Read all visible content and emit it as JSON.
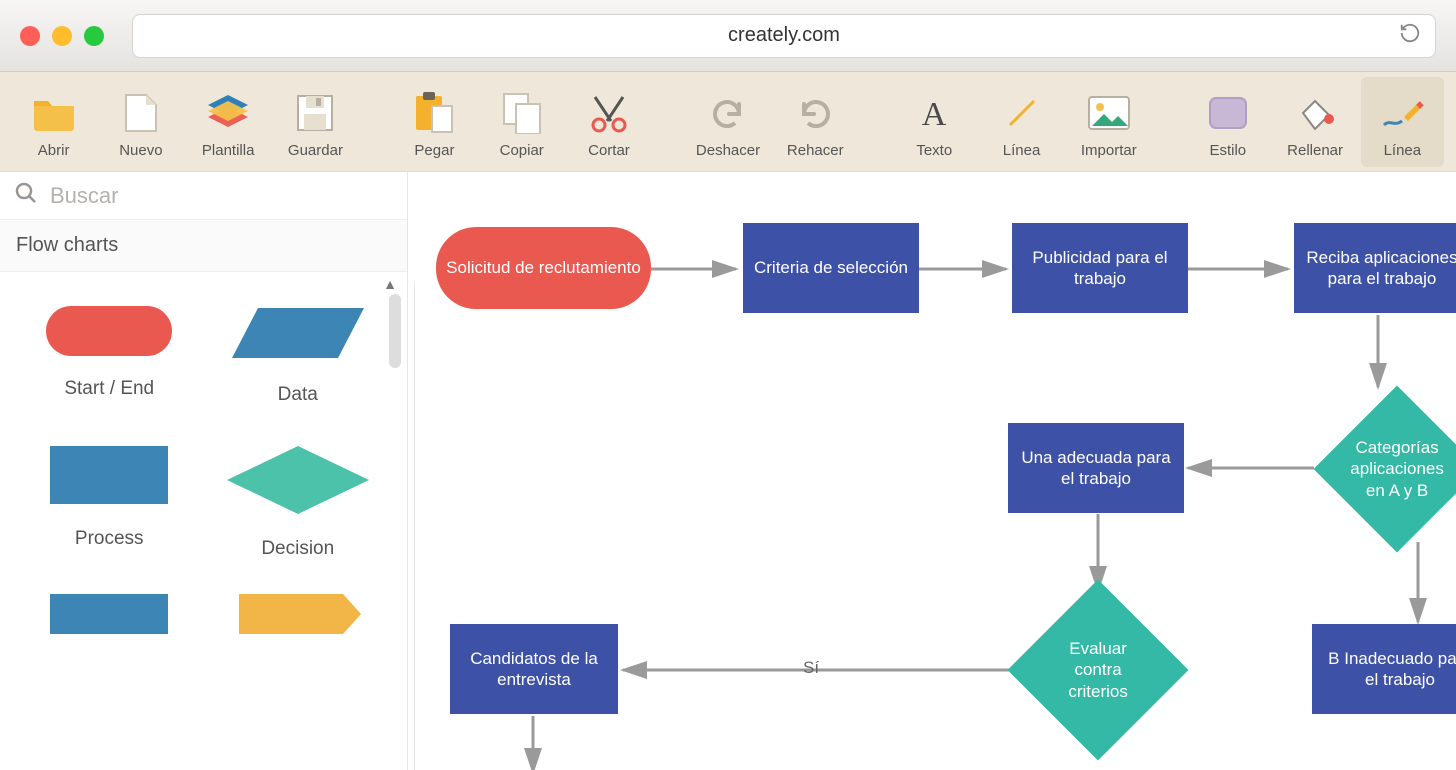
{
  "browser": {
    "url": "creately.com"
  },
  "toolbar": {
    "abrir": "Abrir",
    "nuevo": "Nuevo",
    "plantilla": "Plantilla",
    "guardar": "Guardar",
    "pegar": "Pegar",
    "copiar": "Copiar",
    "cortar": "Cortar",
    "deshacer": "Deshacer",
    "rehacer": "Rehacer",
    "texto": "Texto",
    "linea": "Línea",
    "importar": "Importar",
    "estilo": "Estilo",
    "rellenar": "Rellenar",
    "linea2": "Línea"
  },
  "sidebar": {
    "search_placeholder": "Buscar",
    "category": "Flow charts",
    "shapes": {
      "start_end": "Start / End",
      "data": "Data",
      "process": "Process",
      "decision": "Decision"
    }
  },
  "flow": {
    "n1": "Solicitud de reclutamiento",
    "n2": "Criteria de selección",
    "n3": "Publicidad para el trabajo",
    "n4": "Reciba aplicaciones para el trabajo",
    "n5": "Categorías aplicaciones en A y B",
    "n6": "Una adecuada para el trabajo",
    "n7": "Evaluar contra criterios",
    "n8": "Candidatos de la entrevista",
    "n9": "B Inadecuado para el trabajo",
    "edge_si": "Sí"
  },
  "colors": {
    "terminator": "#e9594f",
    "process": "#3d52a6",
    "decision": "#33b9a5",
    "data": "#3c85b5",
    "toolbar_bg": "#efe8da"
  }
}
